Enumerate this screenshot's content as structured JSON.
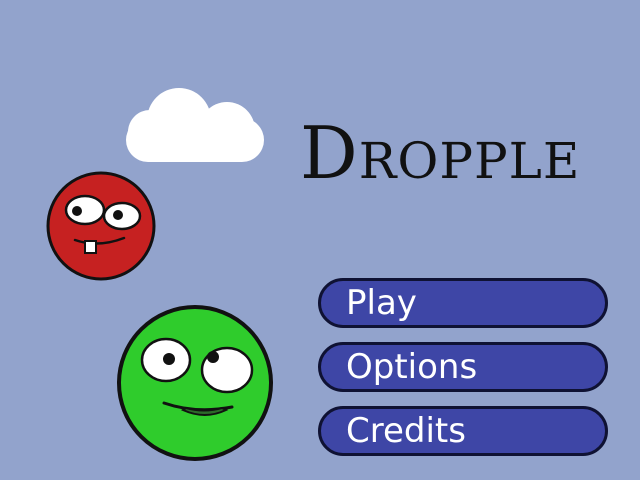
{
  "game": {
    "title": "Dropple",
    "colors": {
      "background": "#92a3cc",
      "button_fill": "#3e46a6",
      "button_border": "#0f1233",
      "red_blob": "#c62121",
      "green_blob": "#2fcc2c",
      "cloud": "#ffffff"
    }
  },
  "menu": {
    "items": [
      {
        "label": "Play"
      },
      {
        "label": "Options"
      },
      {
        "label": "Credits"
      }
    ]
  },
  "decorations": {
    "cloud_icon": "cloud-icon",
    "red_character": "red-blob-character",
    "green_character": "green-blob-character"
  }
}
